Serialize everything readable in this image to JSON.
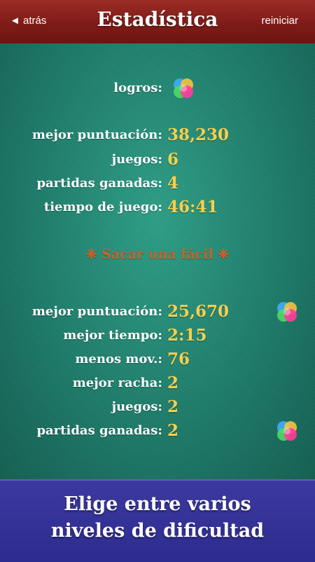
{
  "nav": {
    "back_label": "◄ atrás",
    "title": "Estadística",
    "reset_label": "reiniciar"
  },
  "general": {
    "achievements_label": "logros:",
    "stats": [
      {
        "label": "mejor puntuación:",
        "value": "38,230"
      },
      {
        "label": "juegos:",
        "value": "6"
      },
      {
        "label": "partidas ganadas:",
        "value": "4"
      },
      {
        "label": "tiempo de juego:",
        "value": "46:41"
      }
    ]
  },
  "section": {
    "title": "❈ Sacar una fácil ❈",
    "stats": [
      {
        "label": "mejor puntuación:",
        "value": "25,670"
      },
      {
        "label": "mejor tiempo:",
        "value": "2:15"
      },
      {
        "label": "menos mov.:",
        "value": "76"
      },
      {
        "label": "mejor racha:",
        "value": "2"
      },
      {
        "label": "juegos:",
        "value": "2"
      },
      {
        "label": "partidas ganadas:",
        "value": "2"
      }
    ]
  },
  "banner": {
    "line1": "Elige entre varios",
    "line2": "niveles de dificultad"
  },
  "colors": {
    "navbar": "#7e1c17",
    "felt": "#21826f",
    "value": "#f7cf4f",
    "section_title": "#c9632a",
    "banner": "#2d2b8e"
  },
  "icons": {
    "achievement": "game-center-icon"
  }
}
